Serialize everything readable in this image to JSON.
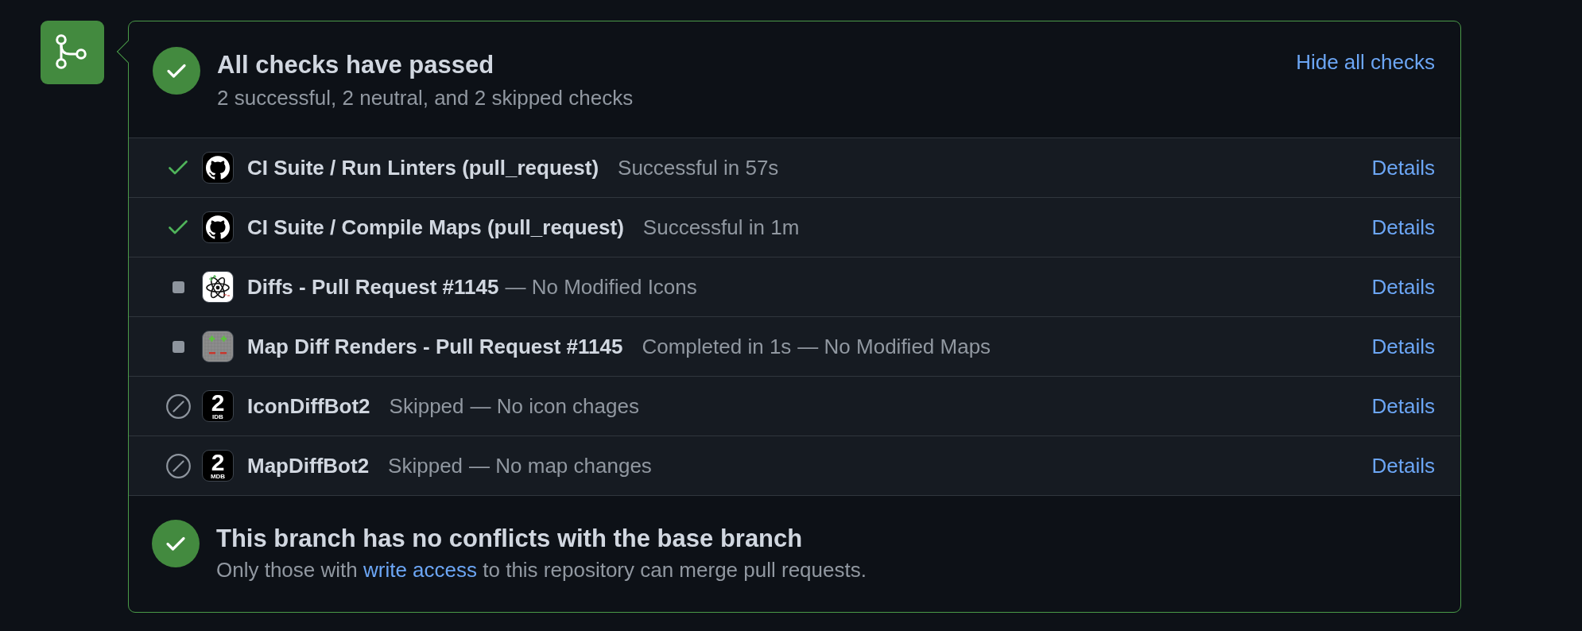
{
  "checks": {
    "title": "All checks have passed",
    "summary": "2 successful, 2 neutral, and 2 skipped checks",
    "toggle_link": "Hide all checks",
    "rows": [
      {
        "kind": "success",
        "avatar": {
          "kind": "github"
        },
        "name": "CI Suite / Run Linters (pull_request)",
        "status_text": "Successful in 57s",
        "link": "Details"
      },
      {
        "kind": "success",
        "avatar": {
          "kind": "github"
        },
        "name": "CI Suite / Compile Maps (pull_request)",
        "status_text": "Successful in 1m",
        "link": "Details"
      },
      {
        "kind": "neutral",
        "avatar": {
          "kind": "atom"
        },
        "name": "Diffs - Pull Request #1145",
        "summary": "— No Modified Icons",
        "link": "Details"
      },
      {
        "kind": "neutral",
        "avatar": {
          "kind": "pixel_grid"
        },
        "name": "Map Diff Renders - Pull Request #1145",
        "status_text": "Completed in 1s",
        "summary": "— No Modified Maps",
        "link": "Details"
      },
      {
        "kind": "skipped",
        "avatar": {
          "kind": "numbered",
          "numeral": "2",
          "label": "IDB"
        },
        "name": "IconDiffBot2",
        "status_text": "Skipped",
        "summary": "— No icon chages",
        "link": "Details"
      },
      {
        "kind": "skipped",
        "avatar": {
          "kind": "numbered",
          "numeral": "2",
          "label": "MDB"
        },
        "name": "MapDiffBot2",
        "status_text": "Skipped",
        "summary": "— No map changes",
        "link": "Details"
      }
    ]
  },
  "merge_status": {
    "title": "This branch has no conflicts with the base branch",
    "message_before": "Only those with ",
    "link": "write access",
    "message_after": " to this repository can merge pull requests."
  }
}
